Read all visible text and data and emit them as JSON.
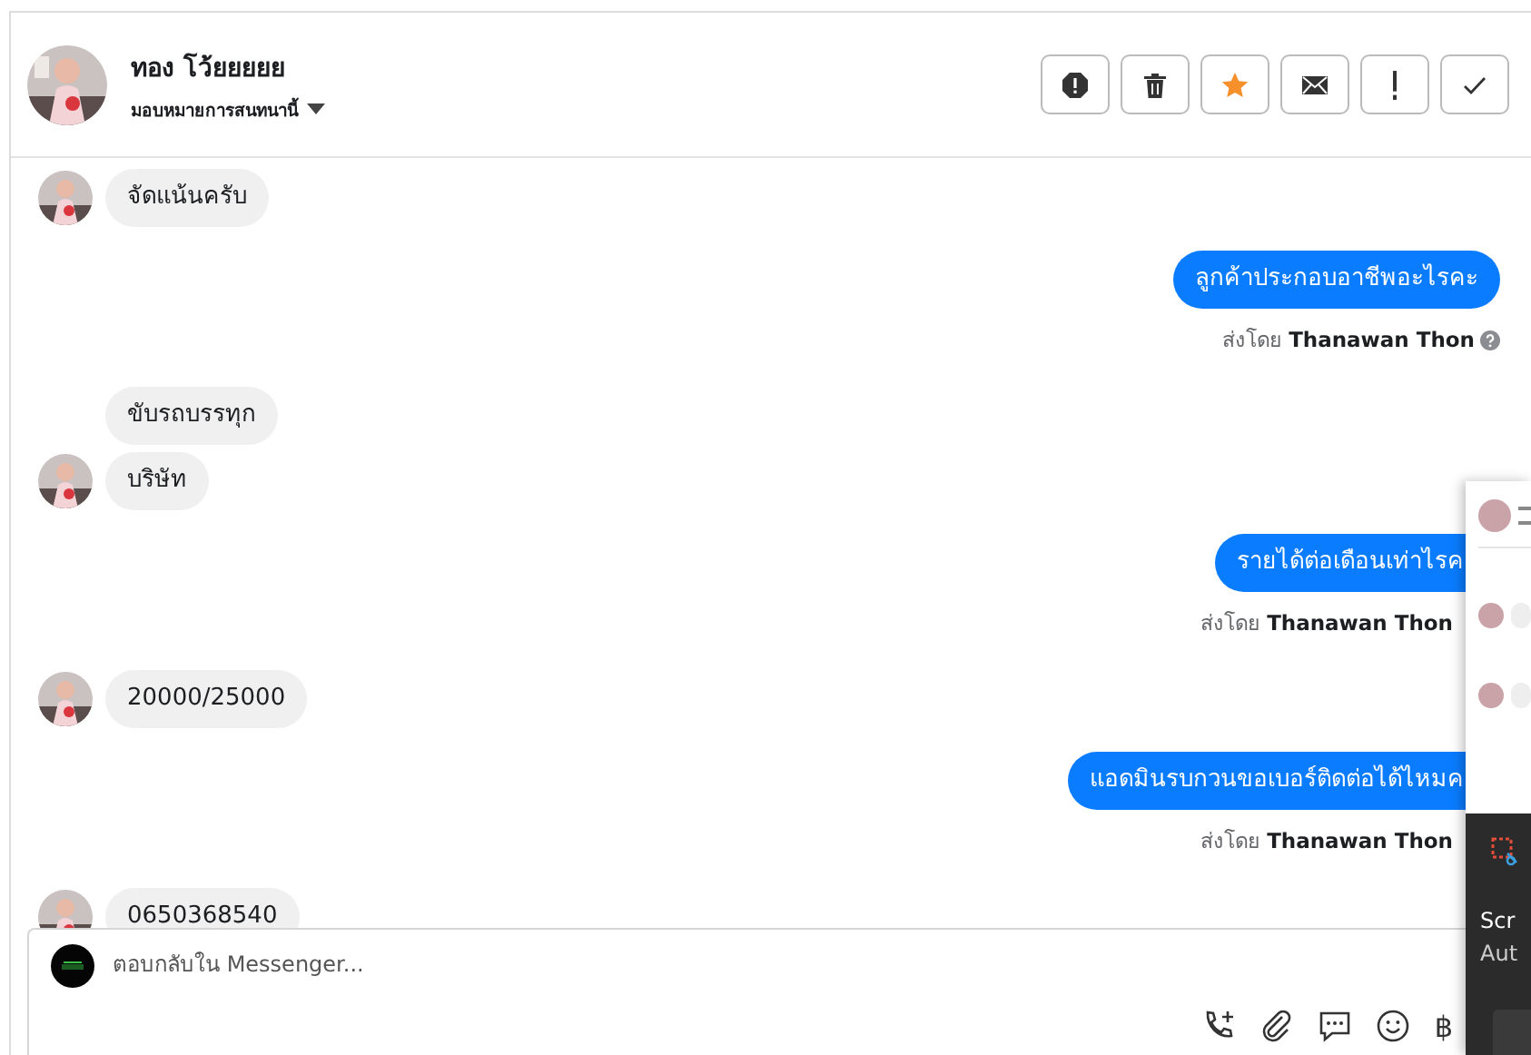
{
  "header": {
    "name": "ทอง โว้ยยยยย",
    "assign_label": "มอบหมายการสนทนานี้",
    "starred": true
  },
  "messages": [
    {
      "kind": "incoming",
      "text": "จัดแน้นครับ",
      "avatar": true
    },
    {
      "kind": "outgoing",
      "text": "ลูกค้าประกอบอาชีพอะไรคะ",
      "sender": "ส่งโดย **Thanawan Thon**",
      "help": true,
      "covered": false
    },
    {
      "kind": "incoming",
      "text": "ขับรถบรรทุก",
      "avatar": false
    },
    {
      "kind": "incoming",
      "text": "บริษัท",
      "avatar": true
    },
    {
      "kind": "outgoing",
      "text": "รายได้ต่อเดือนเท่าไรค",
      "sender": "ส่งโดย **Thanawan Thon**",
      "help": false,
      "covered": true
    },
    {
      "kind": "incoming",
      "text": "20000/25000",
      "avatar": true
    },
    {
      "kind": "outgoing",
      "text": "แอดมินรบกวนขอเบอร์ติดต่อได้ไหมค",
      "sender": "ส่งโดย **Thanawan Thon**",
      "help": false,
      "covered": true
    },
    {
      "kind": "incoming",
      "text": "0650368540",
      "avatar": true
    }
  ],
  "composer": {
    "placeholder": "ตอบกลับใน Messenger...",
    "currency_symbol": "฿"
  },
  "toast": {
    "title": "Scr",
    "body": "Aut"
  }
}
